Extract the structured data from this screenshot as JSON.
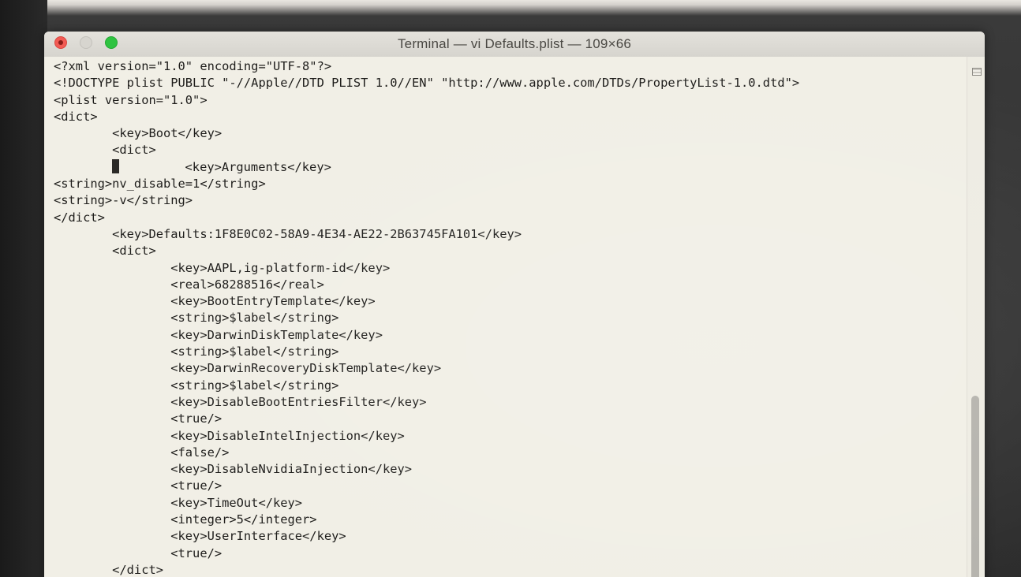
{
  "window": {
    "title": "Terminal — vi Defaults.plist — 109×66",
    "buttons": {
      "close_icon": "close-icon",
      "minimize_icon": "minimize-icon",
      "zoom_icon": "zoom-icon"
    }
  },
  "editor": {
    "lines": [
      "<?xml version=\"1.0\" encoding=\"UTF-8\"?>",
      "<!DOCTYPE plist PUBLIC \"-//Apple//DTD PLIST 1.0//EN\" \"http://www.apple.com/DTDs/PropertyList-1.0.dtd\">",
      "<plist version=\"1.0\">",
      "<dict>",
      "        <key>Boot</key>",
      "        <dict>",
      "                <key>Arguments</key>",
      "<string>nv_disable=1</string>",
      "<string>-v</string>",
      "</dict>",
      "        <key>Defaults:1F8E0C02-58A9-4E34-AE22-2B63745FA101</key>",
      "        <dict>",
      "                <key>AAPL,ig-platform-id</key>",
      "                <real>68288516</real>",
      "                <key>BootEntryTemplate</key>",
      "                <string>$label</string>",
      "                <key>DarwinDiskTemplate</key>",
      "                <string>$label</string>",
      "                <key>DarwinRecoveryDiskTemplate</key>",
      "                <string>$label</string>",
      "                <key>DisableBootEntriesFilter</key>",
      "                <true/>",
      "                <key>DisableIntelInjection</key>",
      "                <false/>",
      "                <key>DisableNvidiaInjection</key>",
      "                <true/>",
      "                <key>TimeOut</key>",
      "                <integer>5</integer>",
      "                <key>UserInterface</key>",
      "                <true/>",
      "        </dict>"
    ],
    "cursor_line": 6
  },
  "colors": {
    "background": "#f1efe6",
    "text": "#1e1d1b",
    "close_button": "#f25b54",
    "zoom_button": "#2fc341"
  }
}
